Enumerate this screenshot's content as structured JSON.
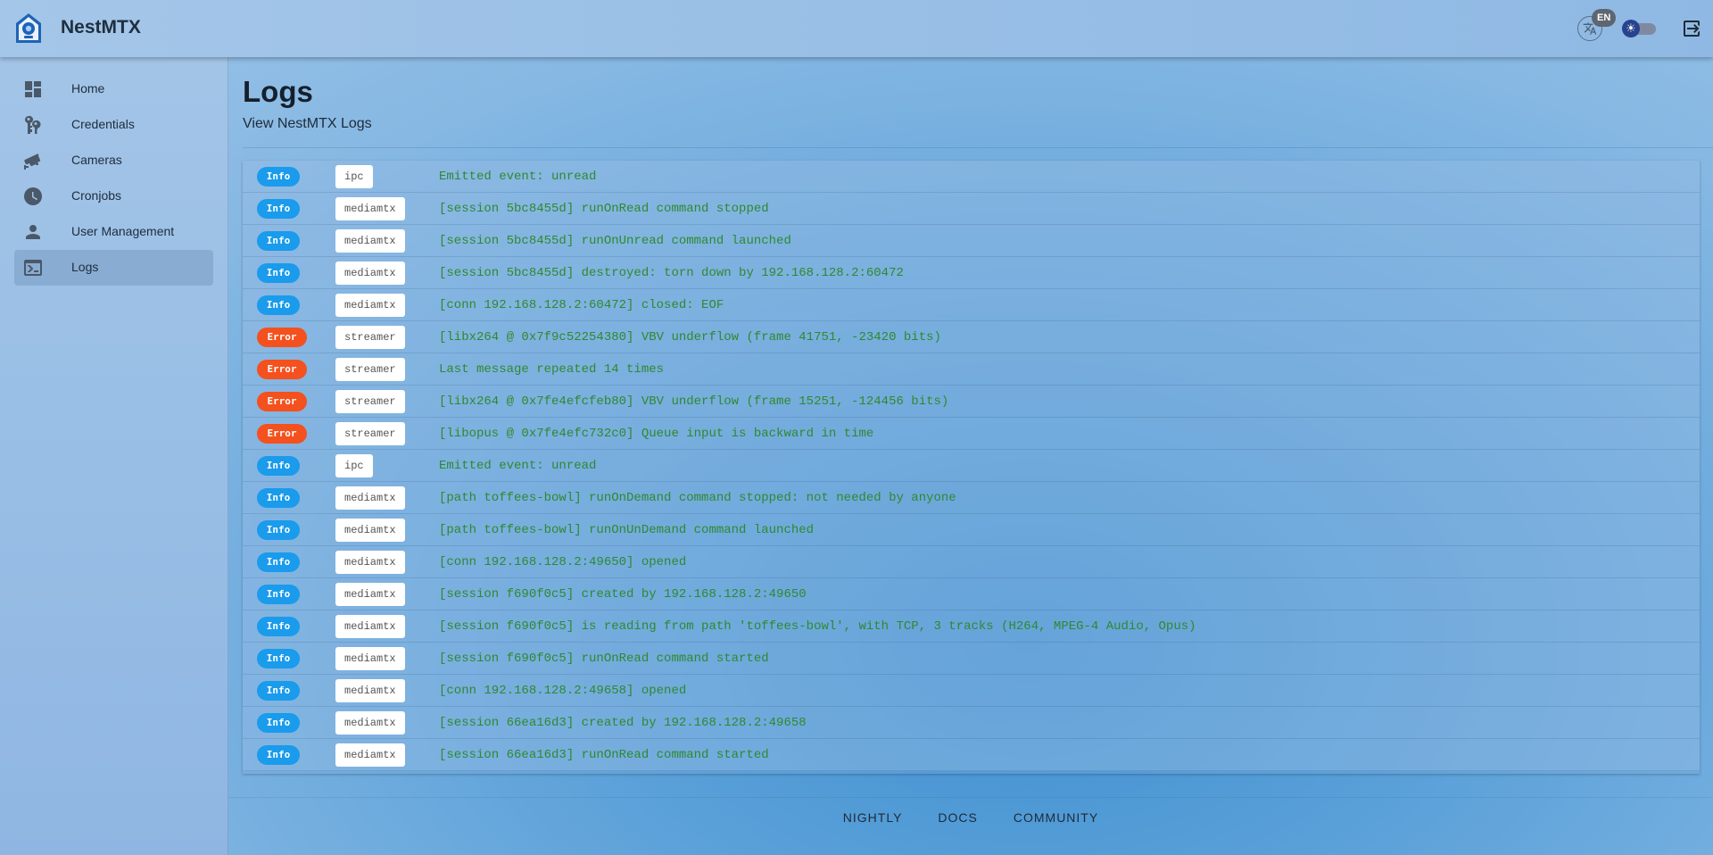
{
  "header": {
    "brand": "NestMTX",
    "language_badge": "EN",
    "icons": {
      "logo": "camera-house-icon",
      "translate": "translate-icon",
      "theme": "sun-icon",
      "logout": "logout-icon"
    }
  },
  "sidebar": {
    "items": [
      {
        "label": "Home",
        "icon": "dashboard-icon",
        "active": false
      },
      {
        "label": "Credentials",
        "icon": "key-icon",
        "active": false
      },
      {
        "label": "Cameras",
        "icon": "cctv-icon",
        "active": false
      },
      {
        "label": "Cronjobs",
        "icon": "clock-icon",
        "active": false
      },
      {
        "label": "User Management",
        "icon": "user-icon",
        "active": false
      },
      {
        "label": "Logs",
        "icon": "console-icon",
        "active": true
      }
    ]
  },
  "page": {
    "title": "Logs",
    "subtitle": "View NestMTX Logs"
  },
  "logs": [
    {
      "level": "Info",
      "source": "ipc",
      "message": "Emitted event: unread"
    },
    {
      "level": "Info",
      "source": "mediamtx",
      "message": "[session 5bc8455d] runOnRead command stopped"
    },
    {
      "level": "Info",
      "source": "mediamtx",
      "message": "[session 5bc8455d] runOnUnread command launched"
    },
    {
      "level": "Info",
      "source": "mediamtx",
      "message": "[session 5bc8455d] destroyed: torn down by 192.168.128.2:60472"
    },
    {
      "level": "Info",
      "source": "mediamtx",
      "message": "[conn 192.168.128.2:60472] closed: EOF"
    },
    {
      "level": "Error",
      "source": "streamer",
      "message": "[libx264 @ 0x7f9c52254380] VBV underflow (frame 41751, -23420 bits)"
    },
    {
      "level": "Error",
      "source": "streamer",
      "message": "Last message repeated 14 times"
    },
    {
      "level": "Error",
      "source": "streamer",
      "message": "[libx264 @ 0x7fe4efcfeb80] VBV underflow (frame 15251, -124456 bits)"
    },
    {
      "level": "Error",
      "source": "streamer",
      "message": "[libopus @ 0x7fe4efc732c0] Queue input is backward in time"
    },
    {
      "level": "Info",
      "source": "ipc",
      "message": "Emitted event: unread"
    },
    {
      "level": "Info",
      "source": "mediamtx",
      "message": "[path toffees-bowl] runOnDemand command stopped: not needed by anyone"
    },
    {
      "level": "Info",
      "source": "mediamtx",
      "message": "[path toffees-bowl] runOnUnDemand command launched"
    },
    {
      "level": "Info",
      "source": "mediamtx",
      "message": "[conn 192.168.128.2:49650] opened"
    },
    {
      "level": "Info",
      "source": "mediamtx",
      "message": "[session f690f0c5] created by 192.168.128.2:49650"
    },
    {
      "level": "Info",
      "source": "mediamtx",
      "message": "[session f690f0c5] is reading from path 'toffees-bowl', with TCP, 3 tracks (H264, MPEG-4 Audio, Opus)"
    },
    {
      "level": "Info",
      "source": "mediamtx",
      "message": "[session f690f0c5] runOnRead command started"
    },
    {
      "level": "Info",
      "source": "mediamtx",
      "message": "[conn 192.168.128.2:49658] opened"
    },
    {
      "level": "Info",
      "source": "mediamtx",
      "message": "[session 66ea16d3] created by 192.168.128.2:49658"
    },
    {
      "level": "Info",
      "source": "mediamtx",
      "message": "[session 66ea16d3] runOnRead command started"
    }
  ],
  "footer": {
    "links": [
      "NIGHTLY",
      "DOCS",
      "COMMUNITY"
    ]
  },
  "colors": {
    "info": "#1a9bec",
    "error": "#f4511e",
    "message": "#2d8a2f"
  }
}
